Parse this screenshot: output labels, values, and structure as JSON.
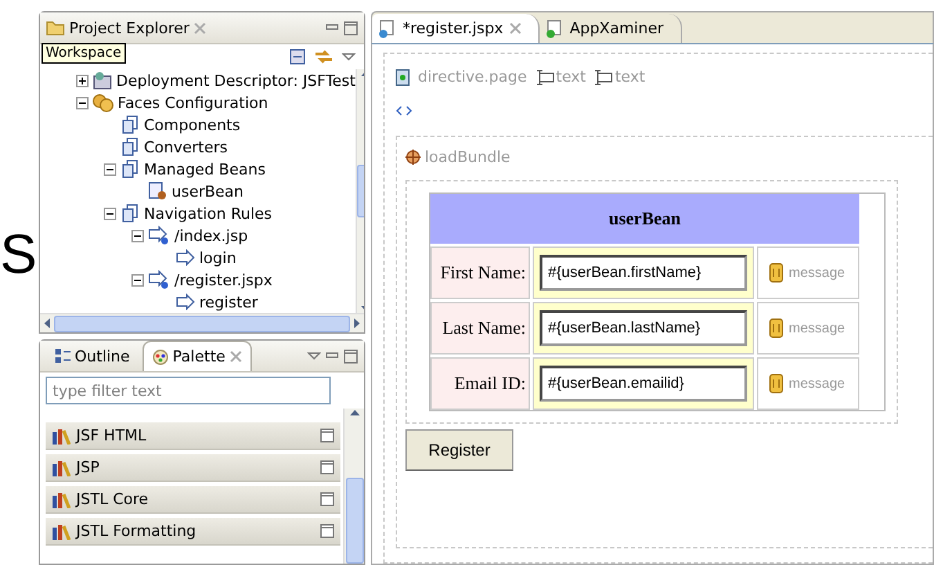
{
  "slide": {
    "letter": "S"
  },
  "explorer": {
    "title": "Project Explorer",
    "tooltip": "Workspace",
    "tree": [
      {
        "label": "Deployment Descriptor: JSFTest",
        "kind": "descriptor",
        "expanded": false
      },
      {
        "label": "Faces Configuration",
        "kind": "faces",
        "expanded": true,
        "children": [
          {
            "label": "Components",
            "kind": "folder"
          },
          {
            "label": "Converters",
            "kind": "folder"
          },
          {
            "label": "Managed Beans",
            "kind": "folder",
            "expanded": true,
            "children": [
              {
                "label": "userBean",
                "kind": "bean"
              }
            ]
          },
          {
            "label": "Navigation Rules",
            "kind": "folder",
            "expanded": true,
            "children": [
              {
                "label": "/index.jsp",
                "kind": "rule",
                "expanded": true,
                "children": [
                  {
                    "label": "login",
                    "kind": "case"
                  }
                ]
              },
              {
                "label": "/register.jspx",
                "kind": "rule",
                "expanded": true,
                "children": [
                  {
                    "label": "register",
                    "kind": "case"
                  }
                ]
              }
            ]
          }
        ]
      }
    ]
  },
  "side_tabs": [
    {
      "label": "Outline",
      "selected": false
    },
    {
      "label": "Palette",
      "selected": true
    }
  ],
  "palette": {
    "placeholder": "type filter text",
    "items": [
      "JSF HTML",
      "JSP",
      "JSTL Core",
      "JSTL Formatting"
    ]
  },
  "editor_tabs": [
    {
      "label": "*register.jspx",
      "selected": true
    },
    {
      "label": "AppXaminer",
      "selected": false
    }
  ],
  "canvas": {
    "directive": "directive.page",
    "texts": [
      "text",
      "text"
    ],
    "bundle": "loadBundle",
    "form": {
      "header": "userBean",
      "rows": [
        {
          "label": "First Name:",
          "value": "#{userBean.firstName}",
          "message": "message"
        },
        {
          "label": "Last Name:",
          "value": "#{userBean.lastName}",
          "message": "message"
        },
        {
          "label": "Email ID:",
          "value": "#{userBean.emailid}",
          "message": "message"
        }
      ],
      "button": "Register"
    }
  }
}
